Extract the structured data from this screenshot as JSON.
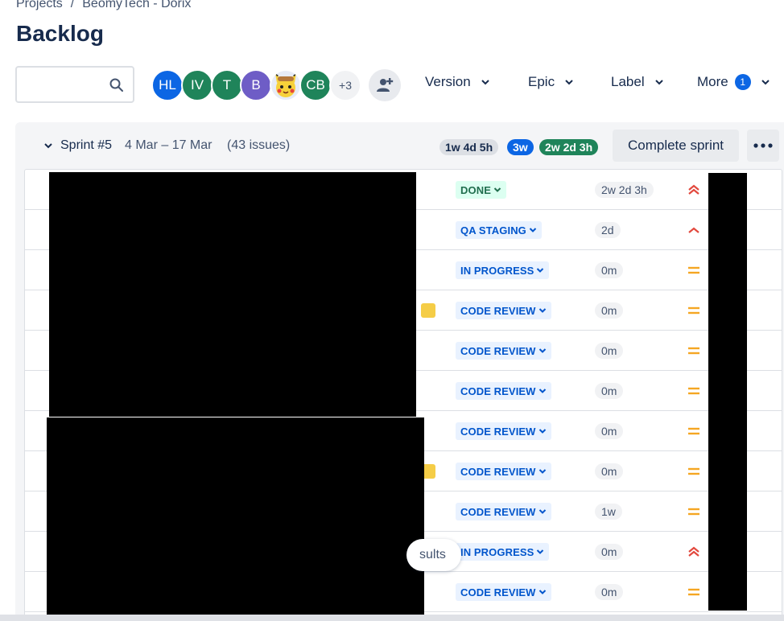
{
  "breadcrumb": {
    "items": [
      "Projects",
      "BeomyTech - Dorix"
    ],
    "separator": "/"
  },
  "page": {
    "title": "Backlog"
  },
  "search": {
    "value": "",
    "placeholder": ""
  },
  "avatars": [
    {
      "initials": "HL",
      "color": "#0c66e4"
    },
    {
      "initials": "IV",
      "color": "#1f845a"
    },
    {
      "initials": "T",
      "color": "#1f845a"
    },
    {
      "initials": "B",
      "color": "#6e5dc6"
    },
    {
      "initials": "",
      "color": "#e7ecf7",
      "icon": "pikachu-avatar-image"
    },
    {
      "initials": "CB",
      "color": "#1f845a"
    }
  ],
  "avatars_more": "+3",
  "filters": {
    "version": "Version",
    "epic": "Epic",
    "label": "Label",
    "more": "More",
    "more_count": "1"
  },
  "sprint": {
    "name": "Sprint #5",
    "dates": "4 Mar – 17 Mar",
    "count": "(43 issues)",
    "estimates": {
      "todo": "1w 4d 5h",
      "in_progress": "3w",
      "done": "2w 2d 3h"
    },
    "complete_label": "Complete sprint"
  },
  "issues": [
    {
      "status": "DONE",
      "estimate": "2w 2d 3h",
      "priority": "highest",
      "flag": false
    },
    {
      "status": "QA STAGING",
      "estimate": "2d",
      "priority": "high",
      "flag": false
    },
    {
      "status": "IN PROGRESS",
      "estimate": "0m",
      "priority": "medium",
      "flag": false
    },
    {
      "status": "CODE REVIEW",
      "estimate": "0m",
      "priority": "medium",
      "flag": true
    },
    {
      "status": "CODE REVIEW",
      "estimate": "0m",
      "priority": "medium",
      "flag": false
    },
    {
      "status": "CODE REVIEW",
      "estimate": "0m",
      "priority": "medium",
      "flag": false
    },
    {
      "status": "CODE REVIEW",
      "estimate": "0m",
      "priority": "medium",
      "flag": false
    },
    {
      "status": "CODE REVIEW",
      "estimate": "0m",
      "priority": "medium",
      "flag": true
    },
    {
      "status": "CODE REVIEW",
      "estimate": "1w",
      "priority": "medium",
      "flag": false
    },
    {
      "status": "IN PROGRESS",
      "estimate": "0m",
      "priority": "highest",
      "flag": false
    },
    {
      "status": "CODE REVIEW",
      "estimate": "0m",
      "priority": "medium",
      "flag": false
    }
  ],
  "tooltip": {
    "text": "sults"
  },
  "colors": {
    "priority_high": "#e2483d",
    "priority_medium": "#f5a623",
    "accent": "#0c66e4"
  }
}
